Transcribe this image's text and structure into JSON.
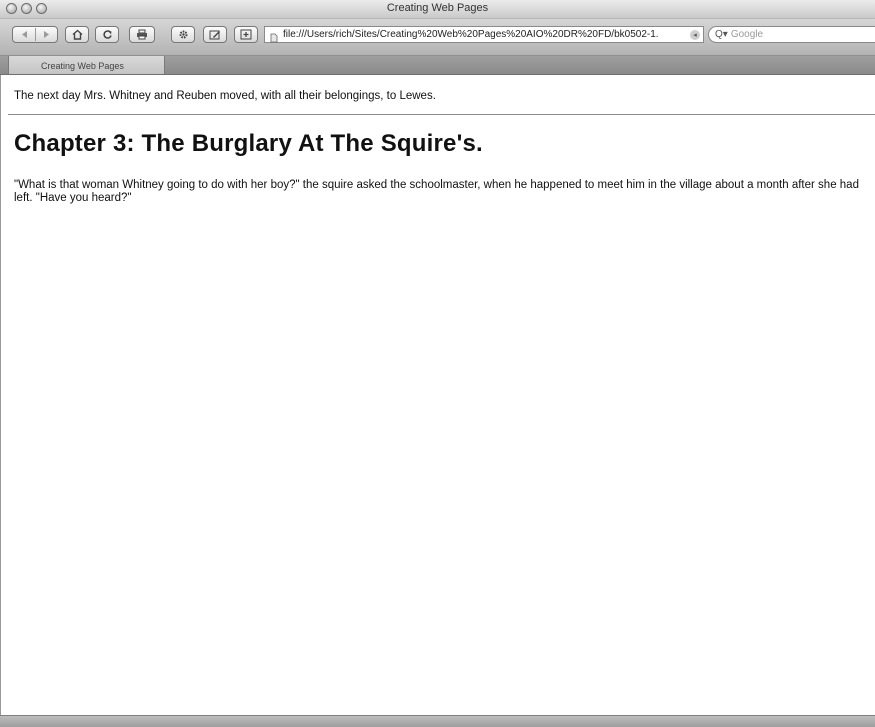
{
  "window": {
    "title": "Creating Web Pages"
  },
  "toolbar": {
    "back_icon": "back-arrow-icon",
    "forward_icon": "forward-arrow-icon",
    "home_icon": "home-icon",
    "reload_icon": "reload-icon",
    "print_icon": "print-icon",
    "settings_icon": "gear-icon",
    "edit_icon": "edit-pencil-icon",
    "add_bookmark_icon": "plus-box-icon",
    "url": "file:///Users/rich/Sites/Creating%20Web%20Pages%20AIO%20DR%20FD/bk0502-1.",
    "search_placeholder": "Google"
  },
  "tabs": [
    {
      "label": "Creating Web Pages"
    }
  ],
  "page": {
    "intro": "The next day Mrs. Whitney and Reuben moved, with all their belongings, to Lewes.",
    "chapter_heading": "Chapter 3: The Burglary At The Squire's.",
    "paragraph": "\"What is that woman Whitney going to do with her boy?\" the squire asked the schoolmaster, when he happened to meet him in the village about a month after she had left. \"Have you heard?\""
  }
}
